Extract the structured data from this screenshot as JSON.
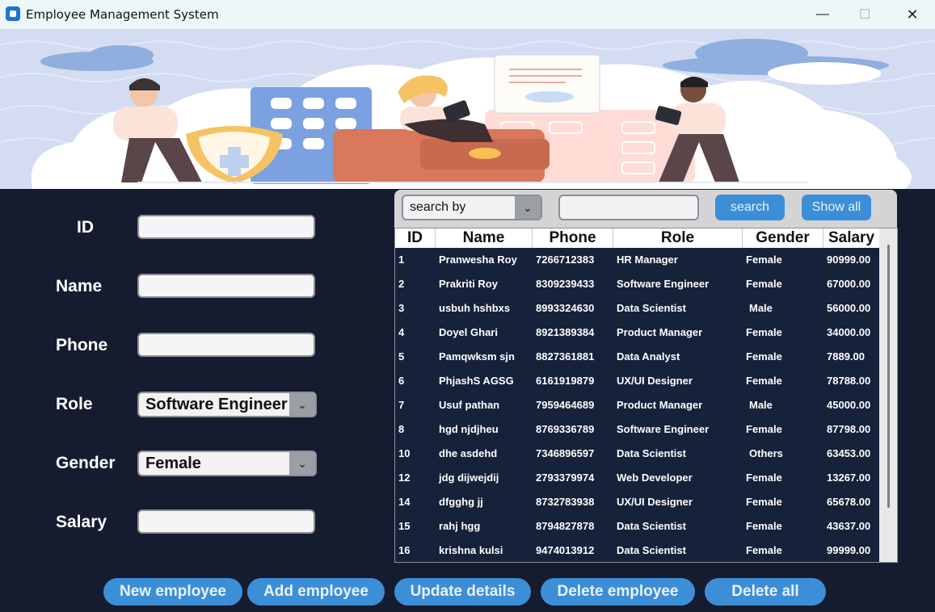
{
  "window": {
    "title": "Employee Management System",
    "minimize": "—",
    "maximize": "☐",
    "close": "✕"
  },
  "form": {
    "id_label": "ID",
    "name_label": "Name",
    "phone_label": "Phone",
    "role_label": "Role",
    "gender_label": "Gender",
    "salary_label": "Salary",
    "id_value": "",
    "name_value": "",
    "phone_value": "",
    "salary_value": "",
    "role_value": "Software Engineer",
    "gender_value": "Female"
  },
  "search": {
    "by_value": "search by",
    "query_value": "",
    "search_label": "search",
    "show_all_label": "Show all"
  },
  "table": {
    "headers": [
      "ID",
      "Name",
      "Phone",
      "Role",
      "Gender",
      "Salary"
    ],
    "rows": [
      [
        "1",
        "Pranwesha Roy",
        "7266712383",
        "HR Manager",
        "Female",
        "90999.00"
      ],
      [
        "2",
        "Prakriti Roy",
        "8309239433",
        "Software Engineer",
        "Female",
        "67000.00"
      ],
      [
        "3",
        "usbuh hshbxs",
        "8993324630",
        "Data Scientist",
        "Male",
        "56000.00"
      ],
      [
        "4",
        "Doyel Ghari",
        "8921389384",
        "Product Manager",
        "Female",
        "34000.00"
      ],
      [
        "5",
        "Pamqwksm sjn",
        "8827361881",
        "Data Analyst",
        "Female",
        "7889.00"
      ],
      [
        "6",
        "PhjashS AGSG",
        "6161919879",
        "UX/UI Designer",
        "Female",
        "78788.00"
      ],
      [
        "7",
        "Usuf pathan",
        "7959464689",
        "Product Manager",
        "Male",
        "45000.00"
      ],
      [
        "8",
        "hgd njdjheu",
        "8769336789",
        "Software Engineer",
        "Female",
        "87798.00"
      ],
      [
        "10",
        "dhe asdehd",
        "7346896597",
        "Data Scientist",
        "Others",
        "63453.00"
      ],
      [
        "12",
        "jdg dijwejdij",
        "2793379974",
        "Web Developer",
        "Female",
        "13267.00"
      ],
      [
        "14",
        "dfgghg jj",
        "8732783938",
        "UX/UI Designer",
        "Female",
        "65678.00"
      ],
      [
        "15",
        "rahj hgg",
        "8794827878",
        "Data Scientist",
        "Female",
        "43637.00"
      ],
      [
        "16",
        "krishna kulsi",
        "9474013912",
        "Data Scientist",
        "Female",
        "99999.00"
      ]
    ]
  },
  "actions": {
    "new_label": "New employee",
    "add_label": "Add employee",
    "update_label": "Update details",
    "delete_label": "Delete employee",
    "delete_all_label": "Delete all"
  },
  "icons": {
    "dropdown": "chevron-down-icon"
  },
  "colors": {
    "background": "#161c2f",
    "accent": "#3c8fd6",
    "banner": "#cfd9ee"
  }
}
